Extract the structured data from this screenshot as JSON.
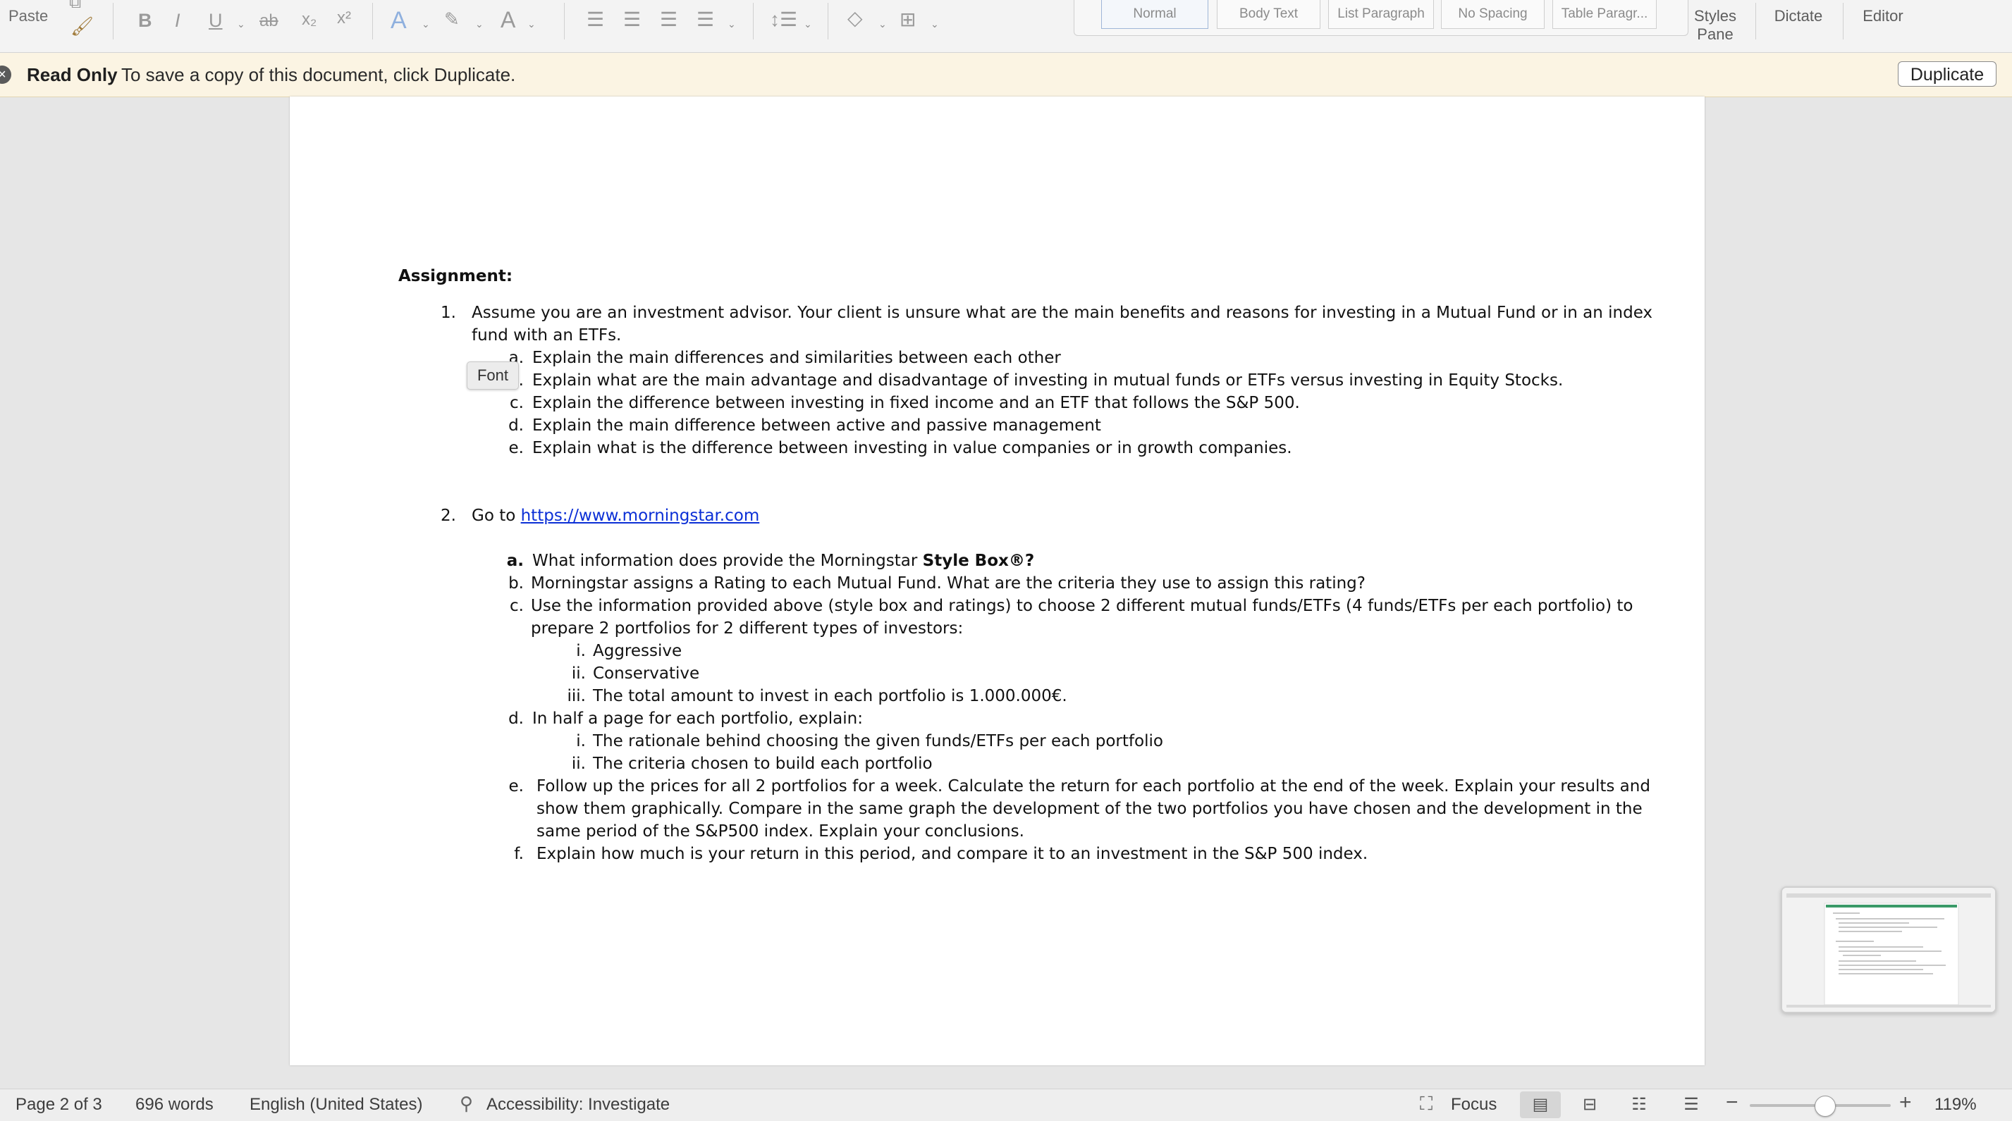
{
  "ribbon": {
    "paste": "Paste",
    "format": {
      "bold": "B",
      "italic": "I",
      "underline": "U",
      "strikethrough": "ab",
      "subscript": "x₂",
      "superscript": "x²"
    },
    "text_effects": "A",
    "font_color": "A",
    "styles": [
      "Normal",
      "Body Text",
      "List Paragraph",
      "No Spacing",
      "Table Paragr..."
    ],
    "styles_pane": [
      "Styles",
      "Pane"
    ],
    "dictate": "Dictate",
    "editor": "Editor"
  },
  "readonly_bar": {
    "title": "Read Only",
    "message": "To save a copy of this document, click Duplicate.",
    "button": "Duplicate"
  },
  "tooltip": "Font",
  "document": {
    "heading": "Assignment:",
    "item1": {
      "num": "1.",
      "line1": "Assume you are an investment advisor. Your client is unsure what are the main benefits and reasons for investing in a Mutual Fund or in an index",
      "line2": "fund with an ETFs.",
      "subs": [
        {
          "label": "a.",
          "text": "Explain the main differences and similarities between each other"
        },
        {
          "label": "b.",
          "text": "Explain what are the main advantage and disadvantage of investing in mutual funds or ETFs versus investing in Equity Stocks."
        },
        {
          "label": "c.",
          "text": "Explain the difference between investing in fixed income and an ETF that follows the S&P 500."
        },
        {
          "label": "d.",
          "text": "Explain the main difference between active and passive management"
        },
        {
          "label": "e.",
          "text": "Explain what is the difference between investing in value companies or in growth companies."
        }
      ]
    },
    "item2": {
      "num": "2.",
      "prefix": "Go to ",
      "link": "https://www.morningstar.com",
      "a": {
        "label": "a.",
        "text": "What information does provide the Morningstar ",
        "bold": "Style Box®?"
      },
      "b": {
        "label": "b.",
        "text": "Morningstar assigns a Rating to each Mutual Fund. What are the criteria they use to assign this rating?"
      },
      "c": {
        "label": "c.",
        "line1": "Use the information provided above (style box and ratings) to choose 2 different mutual funds/ETFs (4 funds/ETFs per each portfolio) to",
        "line2": "prepare 2 portfolios for 2 different types of investors:",
        "subs": [
          {
            "label": "i.",
            "text": "Aggressive"
          },
          {
            "label": "ii.",
            "text": "Conservative"
          },
          {
            "label": "iii.",
            "text": "The total amount to invest in each portfolio is 1.000.000€."
          }
        ]
      },
      "d": {
        "label": "d.",
        "text": "In half a page for each portfolio, explain:",
        "subs": [
          {
            "label": "i.",
            "text": "The rationale behind choosing the given funds/ETFs per each portfolio"
          },
          {
            "label": "ii.",
            "text": "The criteria chosen to build each portfolio"
          }
        ]
      },
      "e": {
        "label": "e.",
        "line1": "Follow up the prices for all 2 portfolios for a week. Calculate the return for each portfolio at the end of the week. Explain your results and",
        "line2": "show them graphically. Compare in the same graph the development of the two portfolios you have chosen and the development in the",
        "line3": "same period of the S&P500 index. Explain your conclusions."
      },
      "f": {
        "label": "f.",
        "text": "Explain how much is your return in this period, and compare it to an investment in the S&P 500 index."
      }
    }
  },
  "status_bar": {
    "page": "Page 2 of 3",
    "words": "696 words",
    "language": "English (United States)",
    "accessibility": "Accessibility: Investigate",
    "focus": "Focus",
    "zoom": "119%",
    "zoom_fraction": 0.53
  }
}
